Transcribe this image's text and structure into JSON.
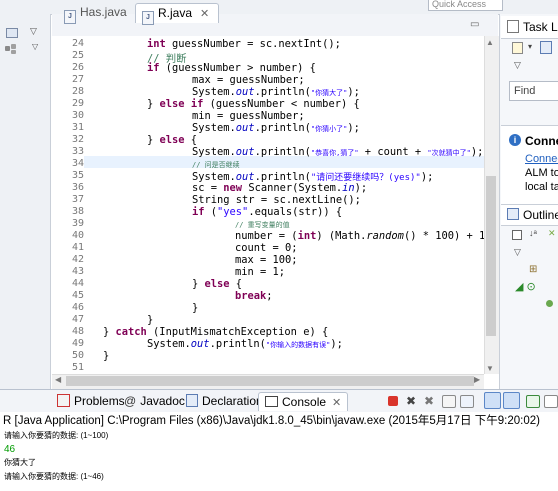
{
  "quick_access": "Quick Access",
  "editor_tabs": [
    {
      "label": "Has.java",
      "active": false
    },
    {
      "label": "R.java",
      "active": true
    }
  ],
  "code_lines": [
    {
      "n": "24"
    },
    {
      "n": "25"
    },
    {
      "n": "26"
    },
    {
      "n": "27"
    },
    {
      "n": "28"
    },
    {
      "n": "29"
    },
    {
      "n": "30"
    },
    {
      "n": "31"
    },
    {
      "n": "32"
    },
    {
      "n": "33"
    },
    {
      "n": "34"
    },
    {
      "n": "35"
    },
    {
      "n": "36"
    },
    {
      "n": "37"
    },
    {
      "n": "38"
    },
    {
      "n": "39"
    },
    {
      "n": "40"
    },
    {
      "n": "41"
    },
    {
      "n": "42"
    },
    {
      "n": "43"
    },
    {
      "n": "44"
    },
    {
      "n": "45"
    },
    {
      "n": "46"
    },
    {
      "n": "47"
    },
    {
      "n": "48"
    },
    {
      "n": "49"
    },
    {
      "n": "50"
    },
    {
      "n": "51"
    }
  ],
  "code": {
    "l24": {
      "kw": "int",
      "rest": " guessNumber = sc.nextInt();"
    },
    "l25": "// 判断",
    "l26": {
      "kw": "if",
      "rest": " (guessNumber > number) {"
    },
    "l27": "max = guessNumber;",
    "l28": {
      "a": "System.",
      "b": "out",
      "c": ".println(",
      "s": "\"你猜大了\"",
      "d": ");"
    },
    "l29": {
      "a": "} ",
      "kw1": "else",
      "b": " ",
      "kw2": "if",
      "c": " (guessNumber < number) {"
    },
    "l30": "min = guessNumber;",
    "l31": {
      "a": "System.",
      "b": "out",
      "c": ".println(",
      "s": "\"你猜小了\"",
      "d": ");"
    },
    "l32": {
      "a": "} ",
      "kw": "else",
      "b": " {"
    },
    "l33": {
      "a": "System.",
      "b": "out",
      "c": ".println(",
      "s1": "\"恭喜你,猜了\"",
      "d": " + count + ",
      "s2": "\"次就猜中了\"",
      "e": ");"
    },
    "l34": "// 问是否继续",
    "l35": {
      "a": "System.",
      "b": "out",
      "c": ".println(",
      "s": "\"请问还要继续吗？(yes)\"",
      "d": ");"
    },
    "l36": {
      "a": "sc = ",
      "kw": "new",
      "b": " Scanner(System.",
      "c": "in",
      "d": ");"
    },
    "l37": "String str = sc.nextLine();",
    "l38": {
      "kw": "if",
      "a": " (",
      "s": "\"yes\"",
      "b": ".equals(str)) {"
    },
    "l39": "// 重写变量的值",
    "l40": {
      "a": "number = (",
      "kw": "int",
      "b": ") (Math.",
      "c": "random",
      "d": "() * 100) + 1;"
    },
    "l41": "count = 0;",
    "l42": "max = 100;",
    "l43": "min = 1;",
    "l44": {
      "a": "} ",
      "kw": "else",
      "b": " {"
    },
    "l45": {
      "kw": "break",
      "a": ";"
    },
    "l46": "}",
    "l47": "}",
    "l48": {
      "a": "} ",
      "kw": "catch",
      "b": " (InputMismatchException e) {"
    },
    "l49": {
      "a": "System.",
      "b": "out",
      "c": ".println(",
      "s": "\"你输入的数据有误\"",
      "d": ");"
    },
    "l50": "}",
    "l51": ""
  },
  "right_panel": {
    "task_list": "Task List",
    "find": "Find",
    "connect_title": "Conne",
    "connect_link": "Connect",
    "connect_text1": "ALM to",
    "connect_text2": "local ta",
    "outline": "Outline"
  },
  "console_tabs": [
    {
      "label": "Problems"
    },
    {
      "label": "Javadoc"
    },
    {
      "label": "Declaration"
    },
    {
      "label": "Console",
      "active": true
    }
  ],
  "console": {
    "description": "R [Java Application] C:\\Program Files (x86)\\Java\\jdk1.8.0_45\\bin\\javaw.exe (2015年5月17日 下午9:20:02)",
    "lines": [
      {
        "text": "请输入你要猜的数据: (1~100)",
        "type": "out"
      },
      {
        "text": "46",
        "type": "in"
      },
      {
        "text": "你猜大了",
        "type": "out"
      },
      {
        "text": "请输入你要猜的数据: (1~46)",
        "type": "out"
      }
    ]
  },
  "colors": {
    "keyword": "#7f0055",
    "string": "#2a00ff",
    "comment": "#3f7f5f",
    "field": "#0000c0",
    "console_input": "#009b00",
    "line_highlight": "#e8f2fe"
  }
}
